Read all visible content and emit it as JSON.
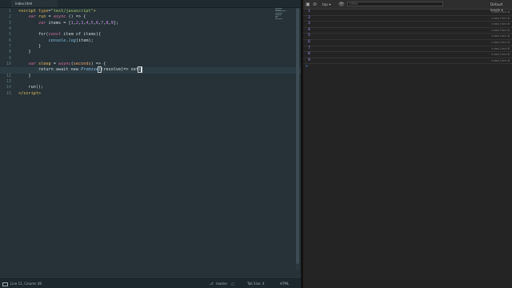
{
  "editor": {
    "tab_label": "index.html",
    "lines": [
      "1",
      "2",
      "3",
      "4",
      "5",
      "6",
      "7",
      "8",
      "9",
      "10",
      "11",
      "12",
      "13",
      "14",
      "15"
    ],
    "current_line_index": 10,
    "status": {
      "position": "Line 11, Column 48",
      "branch": "master",
      "tab_size": "Tab Size: 4",
      "syntax": "HTML"
    }
  },
  "console": {
    "context": "top",
    "filter_placeholder": "Filter",
    "levels": "Default levels",
    "logs": [
      "1",
      "2",
      "3",
      "4",
      "5",
      "6",
      "7",
      "8",
      "9"
    ],
    "log_source": "index.html:6",
    "prompt": ">"
  },
  "colors": {
    "editor_bg": "#263238",
    "console_bg": "#242424",
    "log_text": "#9c8ff0",
    "keyword": "#d06d9c",
    "string": "#9dc46a",
    "number": "#c38ed9"
  }
}
